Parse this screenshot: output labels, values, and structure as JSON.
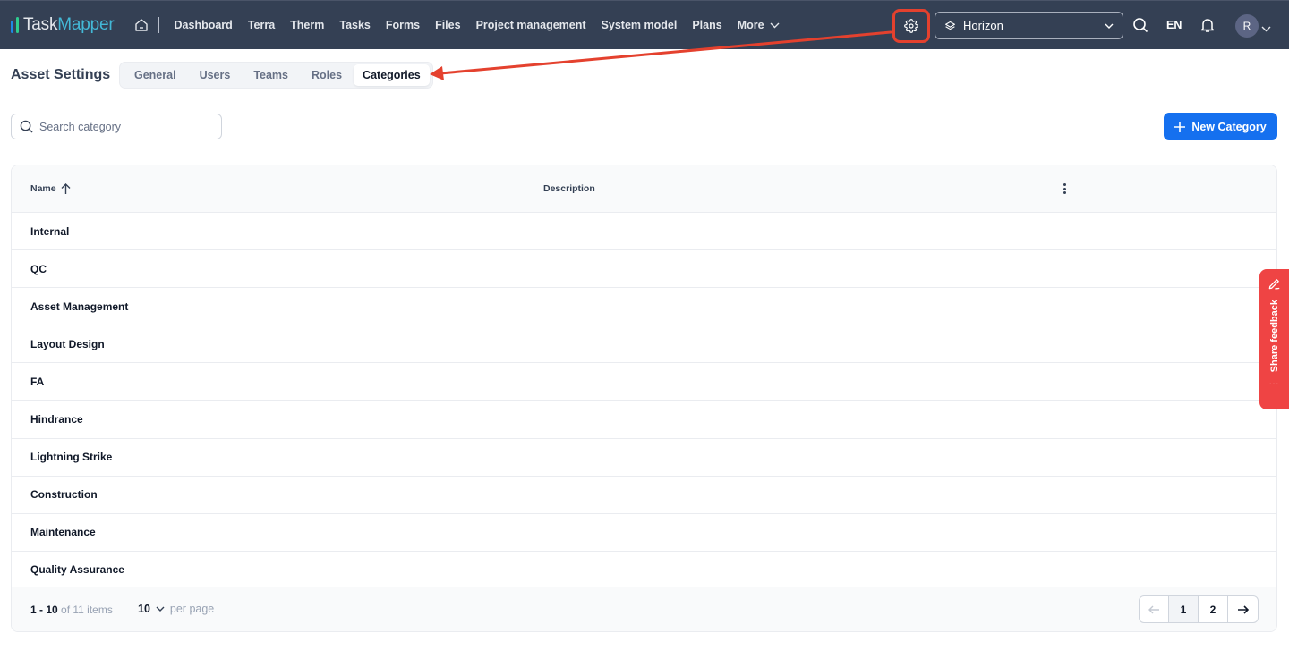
{
  "app": {
    "logo_part1": "Task",
    "logo_part2": "Mapper",
    "brand_colors": {
      "task": "#e4e7ec",
      "mapper": "#43b8d6",
      "bar1": "#1e88e5",
      "bar2": "#2ecc8f"
    }
  },
  "topnav": {
    "items": [
      {
        "label": "Dashboard"
      },
      {
        "label": "Terra"
      },
      {
        "label": "Therm"
      },
      {
        "label": "Tasks"
      },
      {
        "label": "Forms"
      },
      {
        "label": "Files"
      },
      {
        "label": "Project management"
      },
      {
        "label": "System model"
      },
      {
        "label": "Plans"
      }
    ],
    "more_label": "More",
    "icons": {
      "home": "home-icon",
      "settings": "gear-icon",
      "search": "search-icon",
      "notifications": "bell-icon"
    },
    "project_select": {
      "value": "Horizon",
      "icon": "layers-icon"
    },
    "language": "EN",
    "avatar_initial": "R"
  },
  "page": {
    "title": "Asset Settings",
    "tabs": [
      {
        "label": "General",
        "active": false
      },
      {
        "label": "Users",
        "active": false
      },
      {
        "label": "Teams",
        "active": false
      },
      {
        "label": "Roles",
        "active": false
      },
      {
        "label": "Categories",
        "active": true
      }
    ],
    "search": {
      "placeholder": "Search category",
      "value": ""
    },
    "new_button_label": "New Category",
    "accent_color": "#1570ef"
  },
  "table": {
    "columns": [
      {
        "label": "Name",
        "sort": "ascending"
      },
      {
        "label": "Description"
      }
    ],
    "rows": [
      {
        "name": "Internal",
        "description": ""
      },
      {
        "name": "QC",
        "description": ""
      },
      {
        "name": "Asset Management",
        "description": ""
      },
      {
        "name": "Layout Design",
        "description": ""
      },
      {
        "name": "FA",
        "description": ""
      },
      {
        "name": "Hindrance",
        "description": ""
      },
      {
        "name": "Lightning Strike",
        "description": ""
      },
      {
        "name": "Construction",
        "description": ""
      },
      {
        "name": "Maintenance",
        "description": ""
      },
      {
        "name": "Quality Assurance",
        "description": ""
      }
    ],
    "footer": {
      "range": "1 - 10",
      "total_text": "of 11 items",
      "per_page_value": "10",
      "per_page_label": "per page",
      "pages": [
        "1",
        "2"
      ],
      "current_page": "1"
    }
  },
  "feedback_tab": {
    "label": "Share feedback",
    "more": "...",
    "color": "#ef4444"
  },
  "annotation": {
    "color": "#e4412e",
    "description": "Red arrow from settings gear to Categories tab"
  }
}
